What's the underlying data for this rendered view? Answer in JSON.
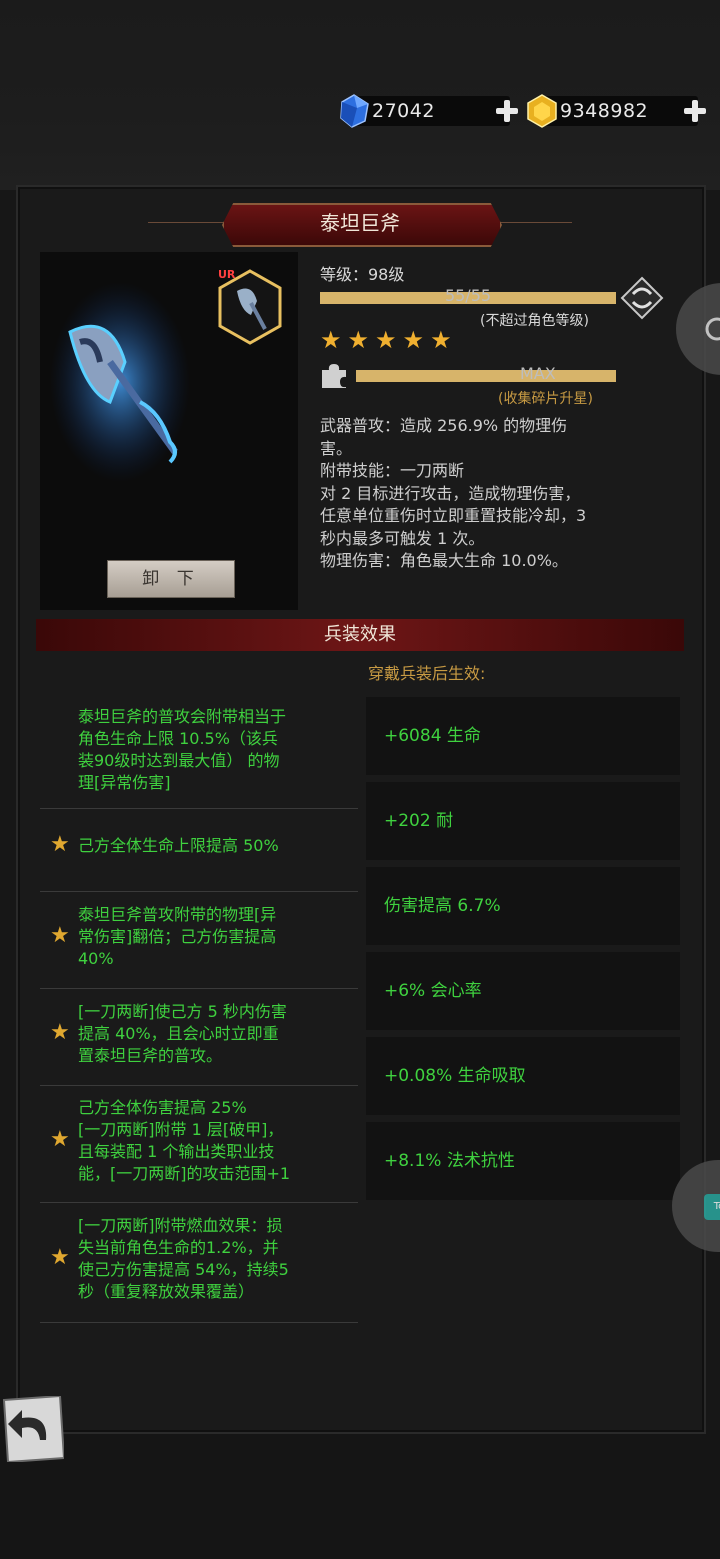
{
  "currency": {
    "gems": "27042",
    "gold": "9348982"
  },
  "item": {
    "name": "泰坦巨斧",
    "rarity_tag": "UR",
    "unequip_label": "卸 下",
    "level_label": "等级：98级",
    "exp_text": "55/55",
    "exp_fraction": 1.0,
    "exp_note": "(不超过角色等级)",
    "stars": "★★★★★",
    "star_count": 5,
    "shard_text": "MAX",
    "shard_fraction": 1.0,
    "shard_note": "(收集碎片升星)",
    "description": [
      "武器普攻：造成 256.9% 的物理伤",
      "害。",
      "附带技能：一刀两断",
      "对 2 目标进行攻击，造成物理伤害，",
      "任意单位重伤时立即重置技能冷却，3",
      "秒内最多可触发 1 次。",
      "物理伤害：角色最大生命 10.0%。"
    ]
  },
  "effects": {
    "title": "兵装效果",
    "subtitle": "穿戴兵装后生效:",
    "list": [
      {
        "text": "泰坦巨斧的普攻会附带相当于\n角色生命上限 10.5%（该兵\n装90级时达到最大值） 的物\n理[异常伤害]",
        "star": false
      },
      {
        "text": "己方全体生命上限提高 50%",
        "star": true
      },
      {
        "text": "泰坦巨斧普攻附带的物理[异\n常伤害]翻倍；己方伤害提高\n40%",
        "star": true
      },
      {
        "text": "[一刀两断]使己方 5 秒内伤害\n提高 40%，且会心时立即重\n置泰坦巨斧的普攻。",
        "star": true
      },
      {
        "text": "己方全体伤害提高 25%\n[一刀两断]附带 1 层[破甲]，\n且每装配 1 个输出类职业技\n能，[一刀两断]的攻击范围+1",
        "star": true
      },
      {
        "text": "[一刀两断]附带燃血效果：损\n失当前角色生命的1.2%，并\n使己方伤害提高 54%，持续5\n秒（重复释放效果覆盖）",
        "star": true
      }
    ],
    "stats": [
      "+6084 生命",
      "+202 耐",
      "伤害提高 6.7%",
      "+6% 会心率",
      "+0.08% 生命吸取",
      "+8.1% 法术抗性"
    ]
  },
  "side": {
    "right_label": "To"
  },
  "colors": {
    "green_text": "#3fd13f",
    "gold_bar": "#d7b46a",
    "banner_red": "#6e1616",
    "star": "#f0b030"
  }
}
